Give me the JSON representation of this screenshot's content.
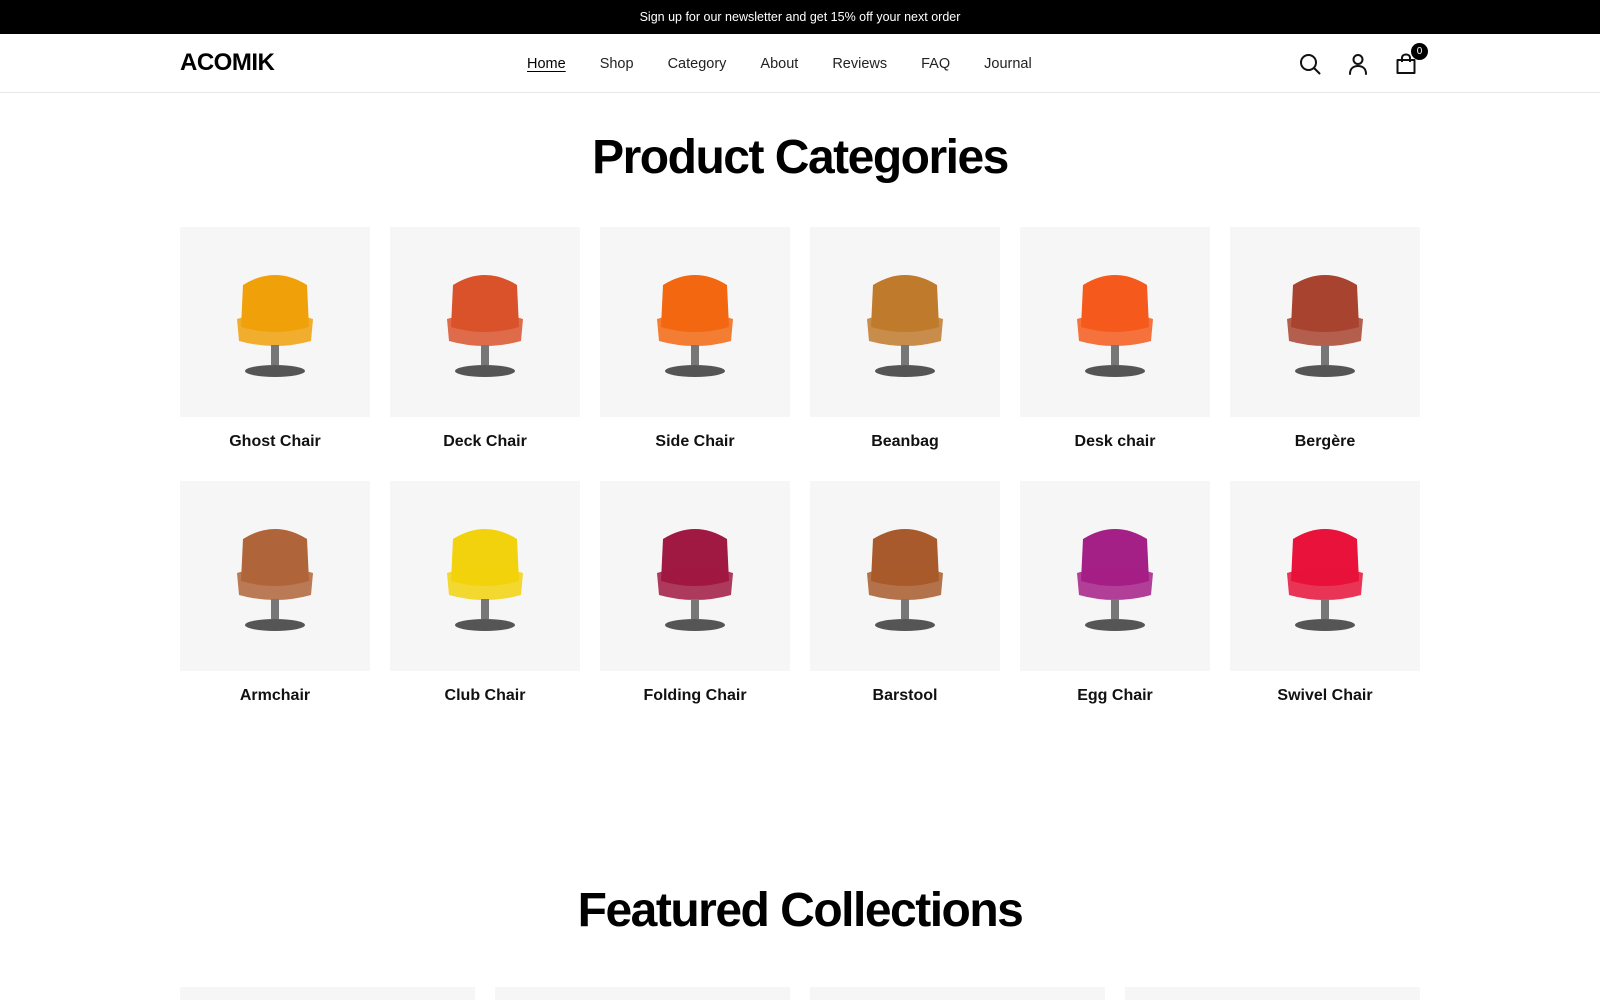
{
  "announcement": "Sign up for our newsletter and get 15% off your next order",
  "header": {
    "logo": "ACOMIK",
    "nav": [
      "Home",
      "Shop",
      "Category",
      "About",
      "Reviews",
      "FAQ",
      "Journal"
    ],
    "active_nav": "Home",
    "cart_count": "0",
    "icons": [
      "search-icon",
      "account-icon",
      "cart-icon"
    ]
  },
  "categories": {
    "title": "Product Categories",
    "items": [
      {
        "label": "Ghost Chair",
        "color": "#f0a10a"
      },
      {
        "label": "Deck Chair",
        "color": "#d9522a"
      },
      {
        "label": "Side Chair",
        "color": "#f2670f"
      },
      {
        "label": "Beanbag",
        "color": "#c07a2c"
      },
      {
        "label": "Desk chair",
        "color": "#f55a1c"
      },
      {
        "label": "Bergère",
        "color": "#a8432f"
      },
      {
        "label": "Armchair",
        "color": "#b0643a"
      },
      {
        "label": "Club Chair",
        "color": "#f2d20c"
      },
      {
        "label": "Folding Chair",
        "color": "#a01942"
      },
      {
        "label": "Barstool",
        "color": "#a85a2c"
      },
      {
        "label": "Egg Chair",
        "color": "#a41f86"
      },
      {
        "label": "Swivel Chair",
        "color": "#e8123a"
      }
    ]
  },
  "featured": {
    "title": "Featured Collections"
  }
}
